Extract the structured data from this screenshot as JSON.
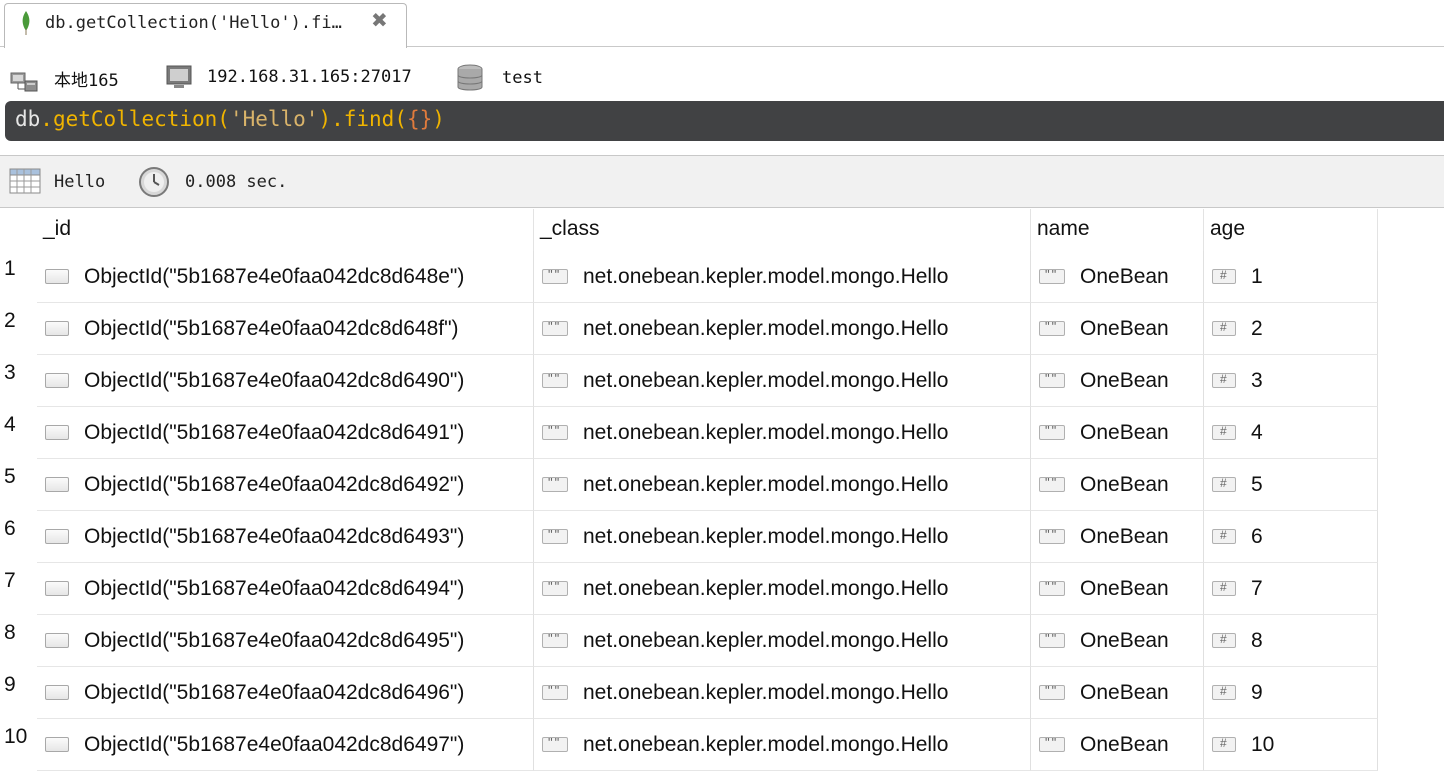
{
  "tab": {
    "title": "db.getCollection('Hello').fi…",
    "close": "✖"
  },
  "connection": {
    "name": "本地165",
    "address": "192.168.31.165:27017",
    "database": "test"
  },
  "query": {
    "p1": "db",
    "p2": ".getCollection(",
    "p3": "'Hello'",
    "p4": ").find(",
    "p5": "{}",
    "p6": ")"
  },
  "result": {
    "collection": "Hello",
    "time": "0.008 sec."
  },
  "table": {
    "columns": [
      "_id",
      "_class",
      "name",
      "age"
    ],
    "rows": [
      {
        "num": "1",
        "id": "ObjectId(\"5b1687e4e0faa042dc8d648e\")",
        "class": "net.onebean.kepler.model.mongo.Hello",
        "name": "OneBean",
        "age": "1"
      },
      {
        "num": "2",
        "id": "ObjectId(\"5b1687e4e0faa042dc8d648f\")",
        "class": "net.onebean.kepler.model.mongo.Hello",
        "name": "OneBean",
        "age": "2"
      },
      {
        "num": "3",
        "id": "ObjectId(\"5b1687e4e0faa042dc8d6490\")",
        "class": "net.onebean.kepler.model.mongo.Hello",
        "name": "OneBean",
        "age": "3"
      },
      {
        "num": "4",
        "id": "ObjectId(\"5b1687e4e0faa042dc8d6491\")",
        "class": "net.onebean.kepler.model.mongo.Hello",
        "name": "OneBean",
        "age": "4"
      },
      {
        "num": "5",
        "id": "ObjectId(\"5b1687e4e0faa042dc8d6492\")",
        "class": "net.onebean.kepler.model.mongo.Hello",
        "name": "OneBean",
        "age": "5"
      },
      {
        "num": "6",
        "id": "ObjectId(\"5b1687e4e0faa042dc8d6493\")",
        "class": "net.onebean.kepler.model.mongo.Hello",
        "name": "OneBean",
        "age": "6"
      },
      {
        "num": "7",
        "id": "ObjectId(\"5b1687e4e0faa042dc8d6494\")",
        "class": "net.onebean.kepler.model.mongo.Hello",
        "name": "OneBean",
        "age": "7"
      },
      {
        "num": "8",
        "id": "ObjectId(\"5b1687e4e0faa042dc8d6495\")",
        "class": "net.onebean.kepler.model.mongo.Hello",
        "name": "OneBean",
        "age": "8"
      },
      {
        "num": "9",
        "id": "ObjectId(\"5b1687e4e0faa042dc8d6496\")",
        "class": "net.onebean.kepler.model.mongo.Hello",
        "name": "OneBean",
        "age": "9"
      },
      {
        "num": "10",
        "id": "ObjectId(\"5b1687e4e0faa042dc8d6497\")",
        "class": "net.onebean.kepler.model.mongo.Hello",
        "name": "OneBean",
        "age": "10"
      }
    ]
  },
  "icons": {
    "tab": "mongodb-leaf-icon",
    "close": "close-icon",
    "server": "server-icon",
    "computer": "computer-icon",
    "database": "database-icon",
    "collection": "grid-table-icon",
    "timer": "clock-icon",
    "objectid": "object-type-icon",
    "string": "string-type-icon",
    "number": "number-type-icon"
  },
  "colors": {
    "query_bg": "#414244",
    "accent_leaf": "#4a9a3a"
  }
}
